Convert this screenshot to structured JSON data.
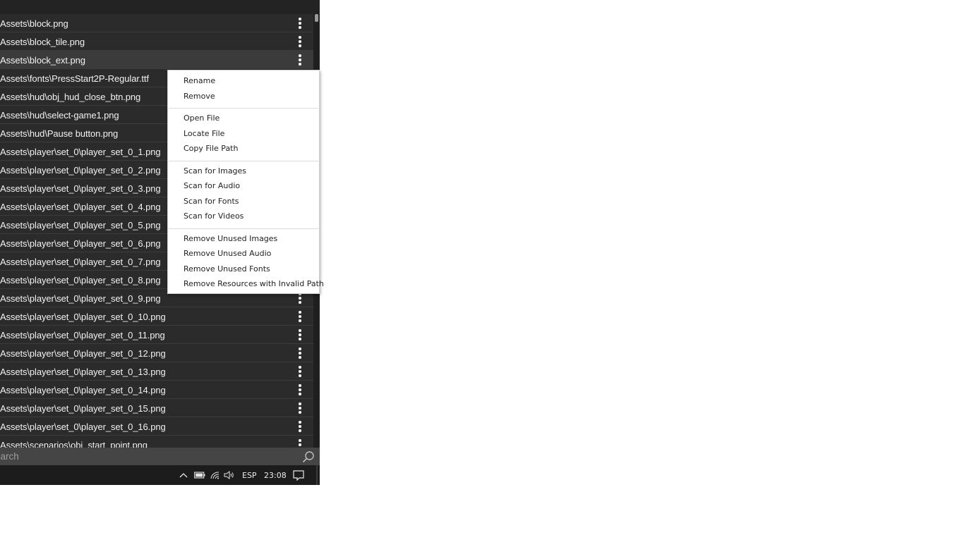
{
  "file_list": {
    "rows": [
      {
        "path": "Assets\\block.png"
      },
      {
        "path": "Assets\\block_tile.png"
      },
      {
        "path": "Assets\\block_ext.png",
        "selected": true
      },
      {
        "path": "Assets\\fonts\\PressStart2P-Regular.ttf"
      },
      {
        "path": "Assets\\hud\\obj_hud_close_btn.png"
      },
      {
        "path": "Assets\\hud\\select-game1.png"
      },
      {
        "path": "Assets\\hud\\Pause button.png"
      },
      {
        "path": "Assets\\player\\set_0\\player_set_0_1.png"
      },
      {
        "path": "Assets\\player\\set_0\\player_set_0_2.png"
      },
      {
        "path": "Assets\\player\\set_0\\player_set_0_3.png"
      },
      {
        "path": "Assets\\player\\set_0\\player_set_0_4.png"
      },
      {
        "path": "Assets\\player\\set_0\\player_set_0_5.png"
      },
      {
        "path": "Assets\\player\\set_0\\player_set_0_6.png"
      },
      {
        "path": "Assets\\player\\set_0\\player_set_0_7.png"
      },
      {
        "path": "Assets\\player\\set_0\\player_set_0_8.png"
      },
      {
        "path": "Assets\\player\\set_0\\player_set_0_9.png"
      },
      {
        "path": "Assets\\player\\set_0\\player_set_0_10.png"
      },
      {
        "path": "Assets\\player\\set_0\\player_set_0_11.png"
      },
      {
        "path": "Assets\\player\\set_0\\player_set_0_12.png"
      },
      {
        "path": "Assets\\player\\set_0\\player_set_0_13.png"
      },
      {
        "path": "Assets\\player\\set_0\\player_set_0_14.png"
      },
      {
        "path": "Assets\\player\\set_0\\player_set_0_15.png"
      },
      {
        "path": "Assets\\player\\set_0\\player_set_0_16.png"
      },
      {
        "path": "Assets\\scenarios\\obj_start_point.png"
      }
    ],
    "row_menu_icon": "more-vertical-icon"
  },
  "search": {
    "placeholder": "earch",
    "icon": "search-icon"
  },
  "context_menu": {
    "groups": [
      [
        "Rename",
        "Remove"
      ],
      [
        "Open File",
        "Locate File",
        "Copy File Path"
      ],
      [
        "Scan for Images",
        "Scan for Audio",
        "Scan for Fonts",
        "Scan for Videos"
      ],
      [
        "Remove Unused Images",
        "Remove Unused Audio",
        "Remove Unused Fonts",
        "Remove Resources with Invalid Path"
      ]
    ]
  },
  "taskbar": {
    "language": "ESP",
    "time": "23:08",
    "icons": [
      "chevron-up-icon",
      "battery-icon",
      "wifi-icon",
      "speaker-icon",
      "notification-icon"
    ]
  },
  "colors": {
    "panel_bg": "#2b2b2b",
    "selected_row_bg": "#3b3b3b",
    "text": "#f2f2f2",
    "taskbar_bg": "#1c1c1c",
    "menu_bg": "#ffffff"
  }
}
